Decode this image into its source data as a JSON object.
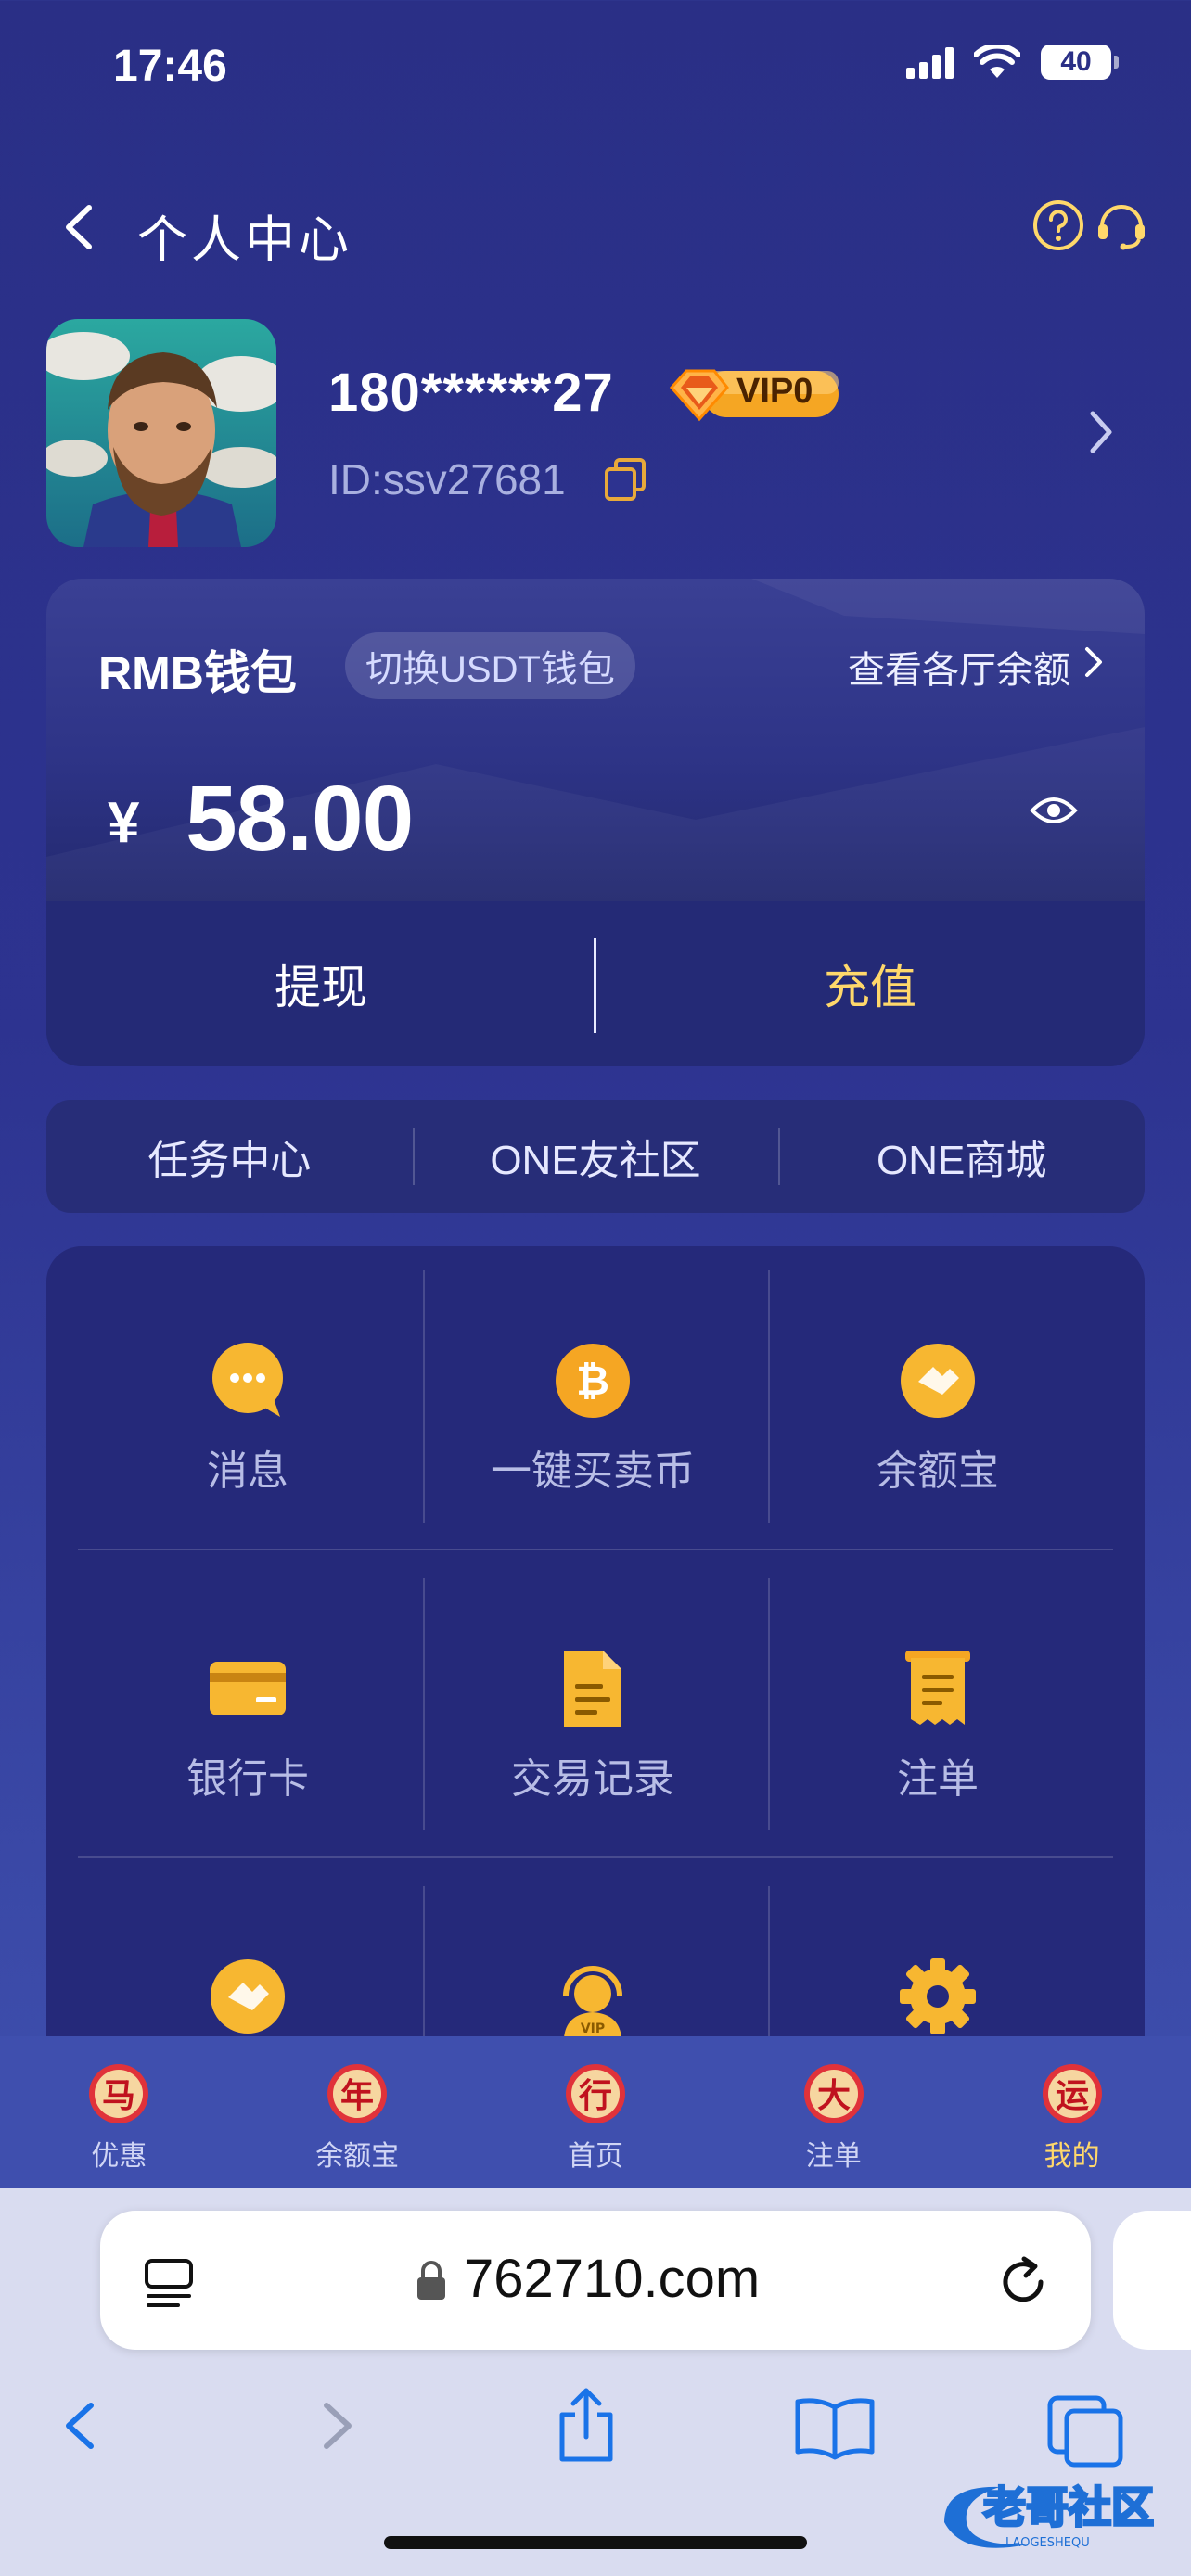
{
  "status_bar": {
    "time": "17:46",
    "battery": "40"
  },
  "nav": {
    "title": "个人中心"
  },
  "profile": {
    "phone": "180******27",
    "vip": "VIP0",
    "id": "ID:ssv27681"
  },
  "wallet": {
    "title": "RMB钱包",
    "switch_label": "切换USDT钱包",
    "balances_link": "查看各厅余额",
    "currency_symbol": "¥",
    "amount": "58.00",
    "withdraw": "提现",
    "deposit": "充值"
  },
  "quick_links": [
    "任务中心",
    "ONE友社区",
    "ONE商城"
  ],
  "grid": [
    {
      "label": "消息",
      "icon": "message-icon"
    },
    {
      "label": "一键买卖币",
      "icon": "bitcoin-icon"
    },
    {
      "label": "余额宝",
      "icon": "yuebao-icon"
    },
    {
      "label": "银行卡",
      "icon": "bank-card-icon"
    },
    {
      "label": "交易记录",
      "icon": "document-icon"
    },
    {
      "label": "注单",
      "icon": "receipt-icon"
    },
    {
      "label": "",
      "icon": "handshake-icon"
    },
    {
      "label": "",
      "icon": "vip-support-icon"
    },
    {
      "label": "",
      "icon": "settings-gear-icon"
    }
  ],
  "tab_bar": [
    {
      "label": "优惠",
      "glyph": "马"
    },
    {
      "label": "余额宝",
      "glyph": "年"
    },
    {
      "label": "首页",
      "glyph": "行"
    },
    {
      "label": "注单",
      "glyph": "大"
    },
    {
      "label": "我的",
      "glyph": "运"
    }
  ],
  "browser": {
    "url": "762710.com"
  },
  "colors": {
    "accent_gold": "#ffd86b",
    "background": "#2a2f86",
    "panel": "#25297a"
  }
}
